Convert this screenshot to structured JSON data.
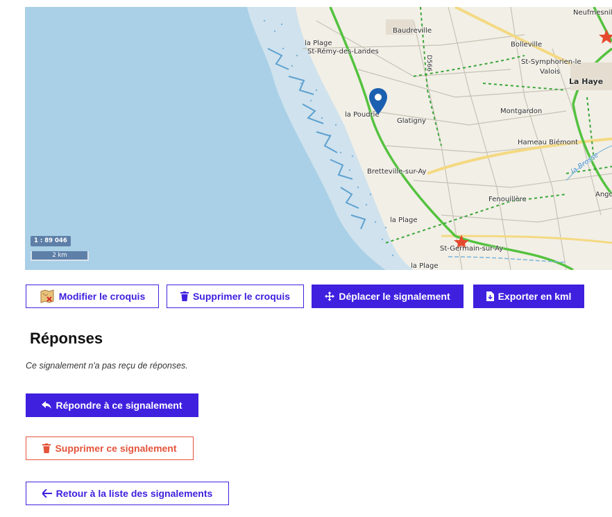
{
  "map": {
    "scale_ratio": "1 : 89 046",
    "scale_bar": "2 km",
    "places": {
      "neufmesnil": "Neufmesnil",
      "baudreville": "Baudreville",
      "la_plage_1": "la Plage",
      "st_remy": "St-Rémy-des-Landes",
      "bolleville": "Bolleville",
      "st_symphorien": "St-Symphorien-le",
      "valois": "Valois",
      "la_haye": "La Haye",
      "la_poudrie": "la Poudrie",
      "glatigny": "Glatigny",
      "montgardon": "Montgardon",
      "hameau_biemont": "Hameau Biémont",
      "la_brosse": "la Brosse",
      "bretteville": "Bretteville-sur-Ay",
      "fenouillere": "Fenouillère",
      "ango": "Ango",
      "la_plage_2": "la Plage",
      "st_germain": "St-Germain-sur-Ay",
      "la_plage_3": "la Plage",
      "road_d566": "D566"
    },
    "colors": {
      "sea": "#a9d0e6",
      "land": "#f2efe6",
      "green_route": "#54c23f",
      "yellow_road": "#f4d982",
      "marker": "#1b5fb0",
      "star": "#e6492d"
    }
  },
  "actions": {
    "edit_sketch": "Modifier le croquis",
    "delete_sketch": "Supprimer le croquis",
    "move_report": "Déplacer le signalement",
    "export_kml": "Exporter en kml"
  },
  "responses": {
    "title": "Réponses",
    "empty_message": "Ce signalement n'a pas reçu de réponses.",
    "reply_button": "Répondre à ce signalement",
    "delete_button": "Supprimer ce signalement",
    "back_button": "Retour à la liste des signalements"
  }
}
